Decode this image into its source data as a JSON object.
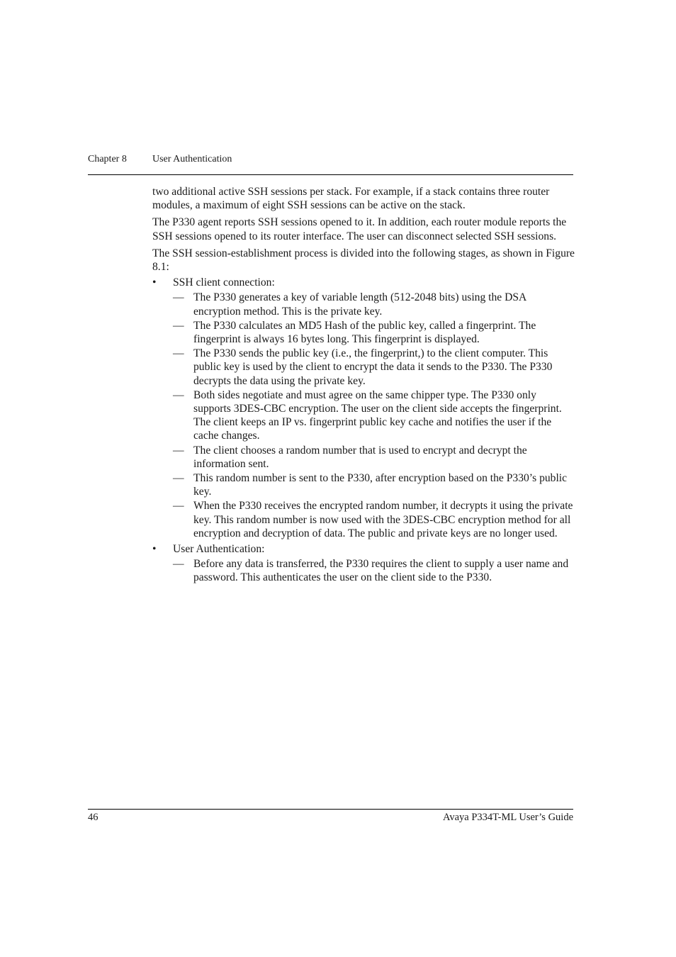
{
  "header": {
    "chapter": "Chapter 8",
    "title": "User Authentication"
  },
  "body": {
    "paragraphs": [
      "two additional active SSH sessions per stack. For example, if a stack contains three router modules, a maximum of eight SSH sessions can be active on the stack.",
      "The P330 agent reports SSH sessions opened to it. In addition, each router module reports the SSH sessions opened to its router interface. The user can disconnect selected SSH sessions.",
      "The SSH session-establishment process is divided into the following stages, as shown in Figure 8.1:"
    ],
    "bullet_mark": "•",
    "dash_mark": "—",
    "stages": [
      {
        "label": "SSH client connection:",
        "steps": [
          "The P330 generates a key of variable length (512-2048 bits) using the DSA encryption method. This is the private key.",
          "The P330 calculates an MD5 Hash of the public key, called a fingerprint. The fingerprint is always 16 bytes long. This fingerprint is displayed.",
          "The P330 sends the public key (i.e., the fingerprint,) to the client computer. This public key is used by the client to encrypt the data it sends to the P330. The P330 decrypts the data using the private key.",
          "Both sides negotiate and must agree on the same chipper type. The P330 only supports 3DES-CBC encryption. The user on the client side accepts the fingerprint. The client keeps an IP vs. fingerprint public key cache and notifies the user if the cache changes.",
          "The client chooses a random number that is used to encrypt and decrypt the information sent.",
          "This random number is sent to the P330, after encryption based on the P330’s public key.",
          "When the P330 receives the encrypted random number, it decrypts it using the private key. This random number is now used with the 3DES-CBC encryption method for all encryption and decryption of data. The public and private keys are no longer used."
        ]
      },
      {
        "label": "User Authentication:",
        "steps": [
          "Before any data is transferred, the P330 requires the client to supply a user name and password. This authenticates the user on the client side to the P330."
        ]
      }
    ]
  },
  "footer": {
    "page_number": "46",
    "guide_title": "Avaya P334T-ML User’s Guide"
  }
}
